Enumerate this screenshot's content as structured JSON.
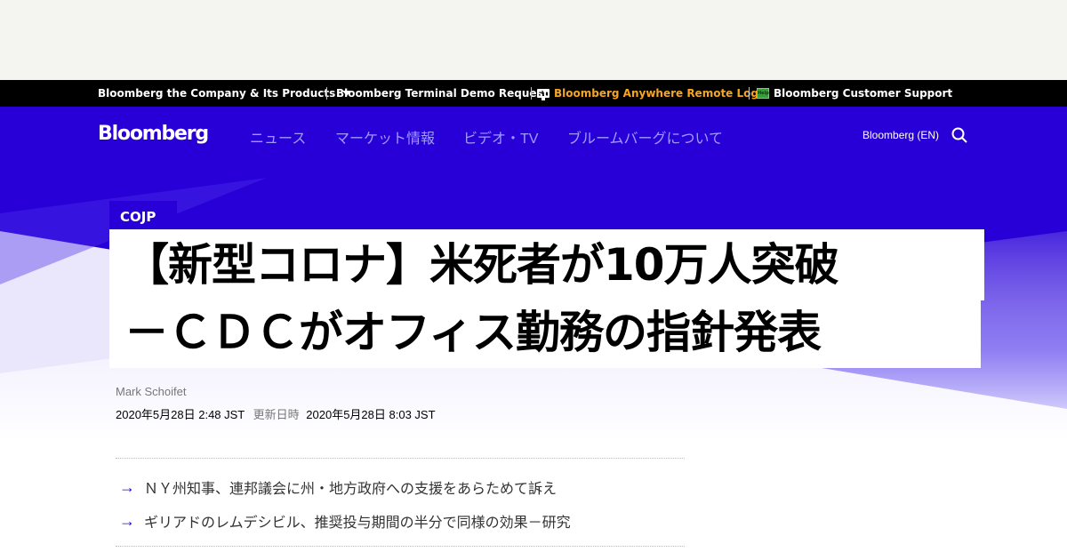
{
  "topbar": {
    "company_label": "Bloomberg the Company & Its Products",
    "demo_label": "Bloomberg Terminal Demo Request",
    "anywhere_label": "Bloomberg Anywhere Remote Login",
    "support_label": "Bloomberg Customer Support",
    "help_icon_text": "Help"
  },
  "header": {
    "brand": "Bloomberg",
    "nav": [
      "ニュース",
      "マーケット情報",
      "ビデオ・TV",
      "ブルームバーグについて"
    ],
    "edition": "Bloomberg (EN)"
  },
  "article": {
    "tag": "COJP",
    "title_line1": "【新型コロナ】米死者が10万人突破",
    "title_line2": "－ＣＤＣがオフィス勤務の指針発表",
    "author": "Mark Schoifet",
    "published": "2020年5月28日 2:48 JST",
    "updated_label": "更新日時",
    "updated": "2020年5月28日 8:03 JST",
    "bullets": [
      "ＮＹ州知事、連邦議会に州・地方政府への支援をあらためて訴え",
      "ギリアドのレムデシビル、推奨投与期間の半分で同様の効果－研究"
    ]
  },
  "colors": {
    "accent": "#2800d7",
    "nav_text": "#9f9cff",
    "highlight": "#f5a623"
  }
}
